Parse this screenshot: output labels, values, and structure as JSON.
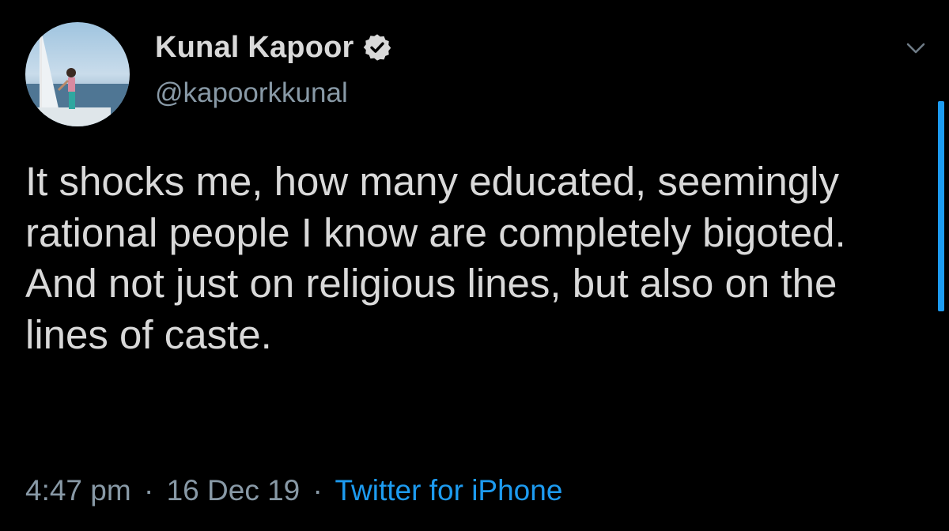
{
  "author": {
    "display_name": "Kunal Kapoor",
    "handle": "@kapoorkkunal",
    "verified_icon": "verified-badge-icon",
    "avatar": "profile-photo-sailboat"
  },
  "tweet": {
    "text": "It shocks me, how many educated, seemingly rational people I know are completely bigoted. And not just on religious lines, but also on the lines of caste."
  },
  "meta": {
    "time": "4:47 pm",
    "separator": "·",
    "date": "16 Dec 19",
    "source": "Twitter for iPhone"
  },
  "icons": {
    "menu": "chevron-down-icon"
  },
  "colors": {
    "background": "#000000",
    "text": "#d9d9d9",
    "secondary": "#8899a6",
    "accent": "#1d9bf0"
  }
}
